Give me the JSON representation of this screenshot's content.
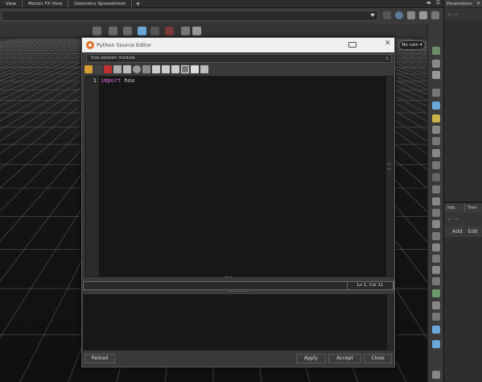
{
  "top_tabs": [
    "View",
    "Motion FX View",
    "Geometry Spreadsheet"
  ],
  "add_tab_symbol": "+",
  "viewport": {
    "camera_label": "No cam ▾"
  },
  "parameters_panel": {
    "title": "Parameters",
    "close_symbol": "✕",
    "nav": "⇐ ⇒"
  },
  "tree_panel": {
    "path_tab": "/obj",
    "tree_tab": "Tree",
    "nav": "⇐ ⇒",
    "add_label": "Add",
    "edit_label": "Edit"
  },
  "dialog": {
    "title": "Python Source Editor",
    "close_symbol": "✕",
    "module_dropdown": "hou.session module",
    "editor": {
      "line_number": "1",
      "keyword": "import",
      "rest": " hou"
    },
    "cursor_position": "Ln 1, Col 11",
    "buttons": {
      "reload": "Reload",
      "apply": "Apply",
      "accept": "Accept",
      "close": "Close"
    }
  },
  "colors": {
    "keyword": "#e070e0",
    "houdini_logo": "#e0722a",
    "accent_icon": "#6aa7d8"
  }
}
